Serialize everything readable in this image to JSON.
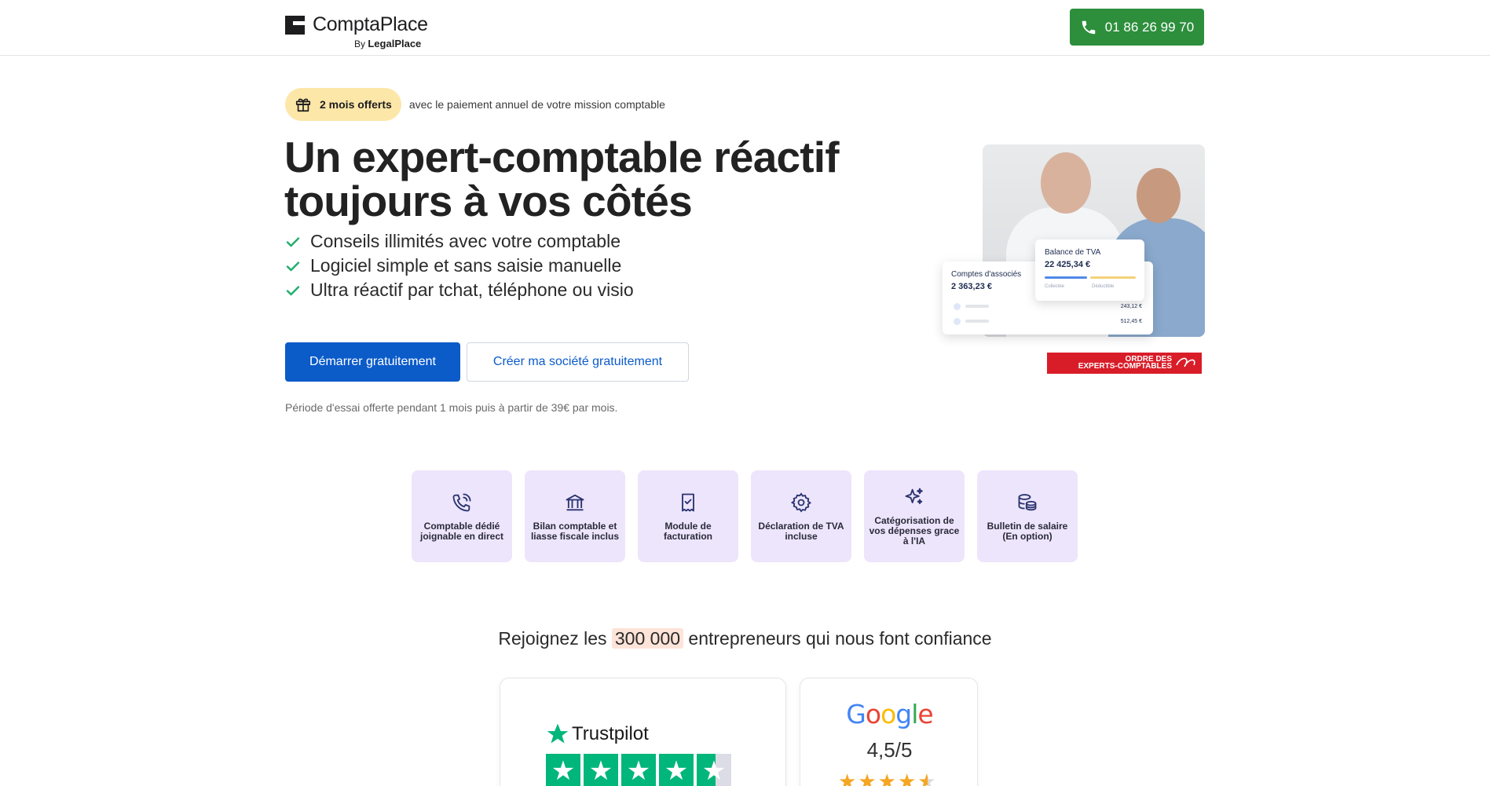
{
  "header": {
    "brand": "ComptaPlace",
    "brand_by": "By",
    "brand_parent": "LegalPlace",
    "phone": "01 86 26 99 70",
    "phone_icon": "phone-icon"
  },
  "promo": {
    "badge": "2 mois offerts",
    "text": "avec le paiement annuel de votre mission comptable",
    "icon": "gift-icon"
  },
  "hero": {
    "title": "Un expert-comptable réactif toujours à vos côtés",
    "benefits": [
      "Conseils illimités avec votre comptable",
      "Logiciel simple et sans saisie manuelle",
      "Ultra réactif par tchat, téléphone ou visio"
    ],
    "cta_primary": "Démarrer gratuitement",
    "cta_secondary": "Créer ma société gratuitement",
    "trial_note": "Période d'essai offerte pendant 1 mois puis à partir de 39€ par mois."
  },
  "hero_cards": {
    "associes_label": "Comptes d'associés",
    "associes_value": "2 363,23 €",
    "tva_label": "Balance de TVA",
    "tva_value": "22 425,34 €",
    "collectee": "Collectée",
    "deductible": "Déductible",
    "row1_amount": "243,12 €",
    "row2_amount": "512,45 €",
    "ordre_line1": "ORDRE DES",
    "ordre_line2": "EXPERTS-COMPTABLES"
  },
  "features": [
    {
      "label": "Comptable dédié joignable en direct",
      "icon": "phone-call-icon"
    },
    {
      "label": "Bilan comptable et liasse fiscale inclus",
      "icon": "bank-icon"
    },
    {
      "label": "Module de facturation",
      "icon": "receipt-icon"
    },
    {
      "label": "Déclaration de TVA incluse",
      "icon": "gear-icon"
    },
    {
      "label": "Catégorisation de vos dépenses grace à l'IA",
      "icon": "sparkles-icon"
    },
    {
      "label": "Bulletin de salaire (En option)",
      "icon": "coins-icon"
    }
  ],
  "trust": {
    "prefix": "Rejoignez les",
    "highlight": "300 000",
    "suffix": "entrepreneurs qui nous font confiance",
    "trustpilot_label": "Trustpilot",
    "google_label": "Google",
    "google_score": "4,5/5",
    "google_rating": 4.5,
    "trustpilot_rating": 4.5
  },
  "colors": {
    "primary_blue": "#0b5bc9",
    "phone_green": "#2d8f3c",
    "promo_yellow": "#fde7a8",
    "feature_lilac": "#ede5fb",
    "check_green": "#1fae6b",
    "trustpilot_green": "#00b67a"
  }
}
